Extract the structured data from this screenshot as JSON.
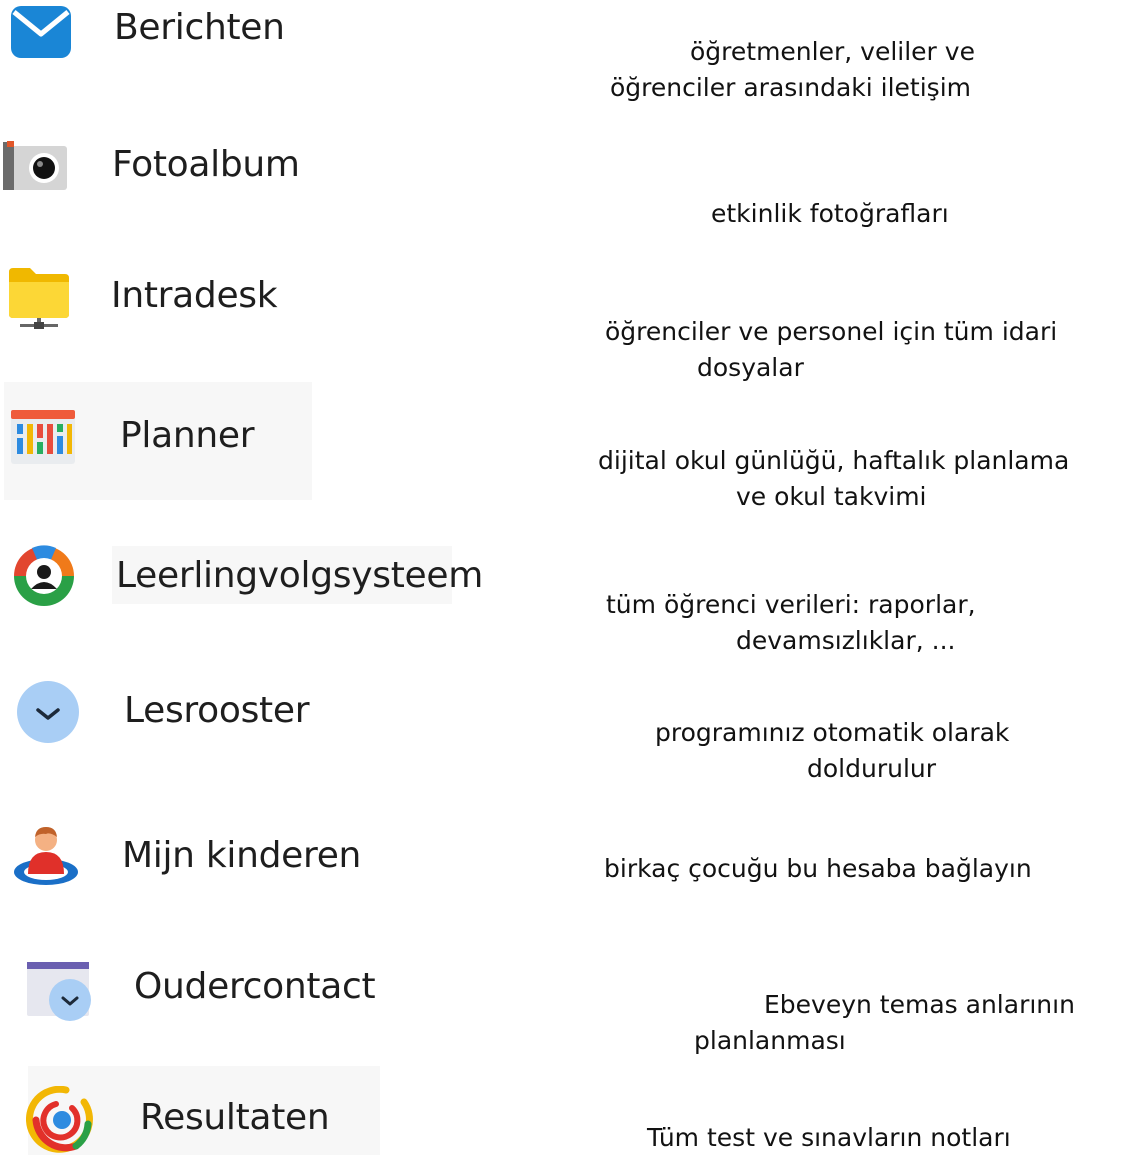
{
  "modules": [
    {
      "icon": "envelope-icon",
      "label": "Berichten",
      "description": [
        "öğretmenler, veliler ve",
        "öğrenciler arasındaki iletişim"
      ]
    },
    {
      "icon": "camera-icon",
      "label": "Fotoalbum",
      "description": [
        "etkinlik fotoğrafları"
      ]
    },
    {
      "icon": "folder-icon",
      "label": "Intradesk",
      "description": [
        "öğrenciler ve personel için tüm idari",
        "dosyalar"
      ]
    },
    {
      "icon": "planner-icon",
      "label": "Planner",
      "description": [
        "dijital okul günlüğü, haftalık planlama",
        "ve okul takvimi"
      ]
    },
    {
      "icon": "student-tracking-icon",
      "label": "Leerlingvolgsysteem",
      "description": [
        "tüm öğrenci verileri: raporlar,",
        "devamsızlıklar, ..."
      ]
    },
    {
      "icon": "schedule-icon",
      "label": "Lesrooster",
      "description": [
        "programınız otomatik olarak",
        "doldurulur"
      ]
    },
    {
      "icon": "children-icon",
      "label": "Mijn kinderen",
      "description": [
        "birkaç çocuğu bu hesaba bağlayın"
      ]
    },
    {
      "icon": "parent-contact-icon",
      "label": "Oudercontact",
      "description": [
        "Ebeveyn temas anlarının",
        "planlanması"
      ]
    },
    {
      "icon": "results-icon",
      "label": "Resultaten",
      "description": [
        "Tüm test ve sınavların notları"
      ]
    }
  ]
}
